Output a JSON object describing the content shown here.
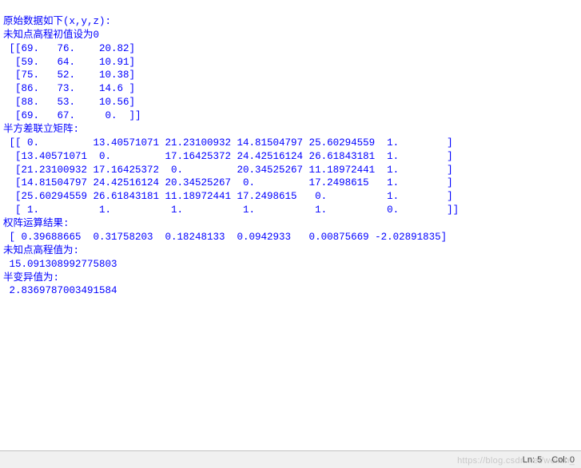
{
  "output": {
    "header1": "原始数据如下(x,y,z):",
    "header2": "未知点高程初值设为0",
    "raw_data_rows": [
      " [[69.   76.    20.82]",
      "  [59.   64.    10.91]",
      "  [75.   52.    10.38]",
      "  [86.   73.    14.6 ]",
      "  [88.   53.    10.56]",
      "  [69.   67.     0.  ]]"
    ],
    "matrix_header": "半方差联立矩阵:",
    "matrix_rows": [
      " [[ 0.         13.40571071 21.23100932 14.81504797 25.60294559  1.        ]",
      "  [13.40571071  0.         17.16425372 24.42516124 26.61843181  1.        ]",
      "  [21.23100932 17.16425372  0.         20.34525267 11.18972441  1.        ]",
      "  [14.81504797 24.42516124 20.34525267  0.         17.2498615   1.        ]",
      "  [25.60294559 26.61843181 11.18972441 17.2498615   0.          1.        ]",
      "  [ 1.          1.          1.          1.          1.          0.        ]]"
    ],
    "weight_header": "权阵运算结果:",
    "weight_row": " [ 0.39688665  0.31758203  0.18248133  0.0942933   0.00875669 -2.02891835]",
    "elev_header": "未知点高程值为:",
    "elev_value": " 15.091308992775803",
    "semivar_header": "半变异值为:",
    "semivar_value": " 2.8369787003491584"
  },
  "statusbar": {
    "ln_label": "Ln:",
    "ln_value": "5",
    "col_label": "Col:",
    "col_value": "0"
  },
  "watermark": "https://blog.csdn.net/weixin_"
}
